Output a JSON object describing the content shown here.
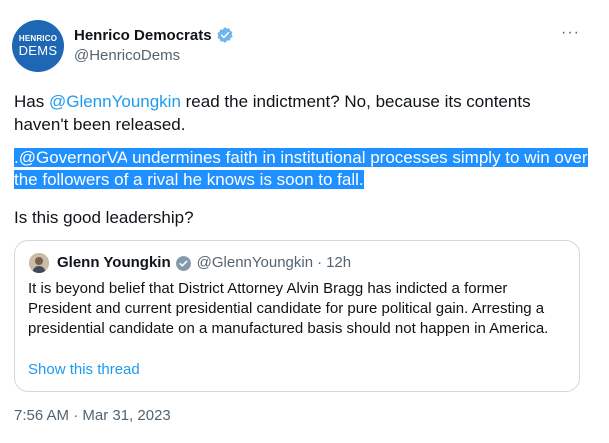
{
  "author": {
    "avatar_line1": "HENRICO",
    "avatar_line2": "DEMS",
    "name": "Henrico Democrats",
    "handle": "@HenricoDems"
  },
  "more_label": "···",
  "tweet": {
    "p1_before": "Has ",
    "p1_mention": "@GlennYoungkin",
    "p1_after": " read the indictment?  No, because its contents haven't been released.",
    "p2_prefix": ".",
    "p2_mention": "@GovernorVA",
    "p2_after": " undermines faith in institutional processes simply to win over the followers of a rival he knows is soon to fall.",
    "p3": "Is this good leadership?"
  },
  "quote": {
    "name": "Glenn Youngkin",
    "handle": "@GlennYoungkin",
    "dot": "·",
    "time": "12h",
    "text": "It is beyond belief that District Attorney Alvin Bragg has indicted a former President and current presidential candidate for pure political gain. Arresting a presidential candidate on a manufactured basis should not happen in America.",
    "show_thread": "Show this thread"
  },
  "timestamp": "7:56 AM · Mar 31, 2023",
  "colors": {
    "link": "#1d9bf0",
    "highlight": "#1e90ff",
    "muted": "#536471",
    "avatar": "#1d67b4"
  },
  "icons": [
    "verified-badge-icon",
    "more-options-icon"
  ]
}
